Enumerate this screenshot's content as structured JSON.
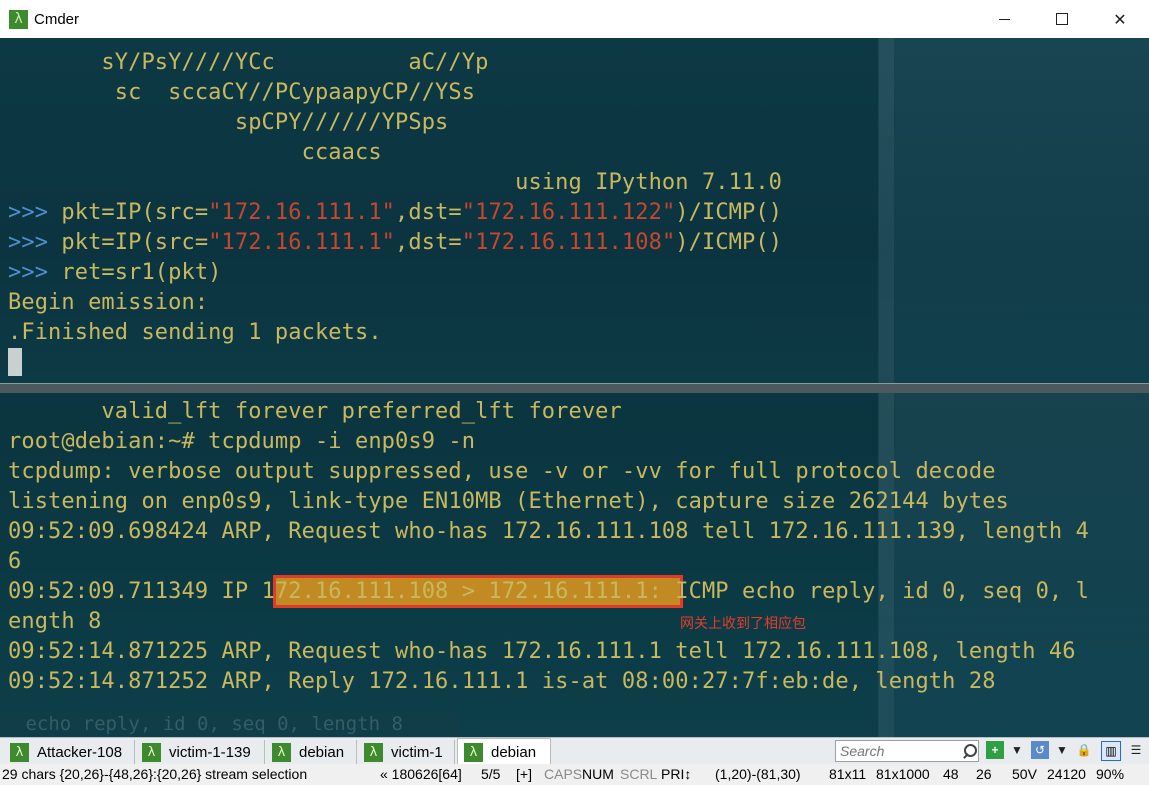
{
  "window": {
    "title": "Cmder",
    "app_icon": "lambda-icon"
  },
  "top_pane": {
    "ascii": [
      "       sY/PsY////YCc          aC//Yp",
      "        sc  sccaCY//PCypaapyCP//YSs",
      "                 spCPY//////YPSps",
      "                      ccaacs",
      "                                      using IPython 7.11.0"
    ],
    "cmd1": {
      "prompt": ">>> ",
      "a": "pkt=IP(src=",
      "s1": "\"172.16.111.1\"",
      "b": ",dst=",
      "s2": "\"172.16.111.122\"",
      "c": ")/ICMP()"
    },
    "cmd2": {
      "prompt": ">>> ",
      "a": "pkt=IP(src=",
      "s1": "\"172.16.111.1\"",
      "b": ",dst=",
      "s2": "\"172.16.111.108\"",
      "c": ")/ICMP()"
    },
    "cmd3": {
      "prompt": ">>> ",
      "a": "ret=sr1(pkt)"
    },
    "out1": "Begin emission:",
    "out2": ".Finished sending 1 packets."
  },
  "bottom_pane": {
    "l1": "       valid_lft forever preferred_lft forever",
    "l2": "root@debian:~# tcpdump -i enp0s9 -n",
    "l3": "tcpdump: verbose output suppressed, use -v or -vv for full protocol decode",
    "l4": "listening on enp0s9, link-type EN10MB (Ethernet), capture size 262144 bytes",
    "l5": "09:52:09.698424 ARP, Request who-has 172.16.111.108 tell 172.16.111.139, length 4",
    "l6": "6",
    "l7_pre": "09:52:09.711349 IP ",
    "l7_hl": "172.16.111.108 > 172.16.111.1",
    "l7_post": ": ICMP echo reply, id 0, seq 0, l",
    "l8": "ength 8",
    "l9": "09:52:14.871225 ARP, Request who-has 172.16.111.1 tell 172.16.111.108, length 46",
    "l10": "09:52:14.871252 ARP, Reply 172.16.111.1 is-at 08:00:27:7f:eb:de, length 28",
    "annotation": "网关上收到了相应包",
    "ghost": " echo reply, id 0, seq 0, length 8"
  },
  "tabs": [
    {
      "label": "Attacker-108"
    },
    {
      "label": "victim-1-139"
    },
    {
      "label": "debian"
    },
    {
      "label": "victim-1"
    },
    {
      "label": "debian",
      "active": true
    }
  ],
  "search": {
    "placeholder": "Search"
  },
  "status": {
    "selection": "29 chars {20,26}-{48,26}:{20,26} stream selection",
    "nav": "« 180626[64]",
    "cons": "5/5",
    "plus": "[+]",
    "caps": "CAPS",
    "num": "NUM",
    "scrl": "SCRL",
    "pri": "PRI↕",
    "range": "(1,20)-(81,30)",
    "size1": "81x11",
    "size2": "81x1000",
    "n48": "48",
    "n26": "26",
    "v": "50V",
    "n24120": "24120",
    "zoom": "90%"
  }
}
